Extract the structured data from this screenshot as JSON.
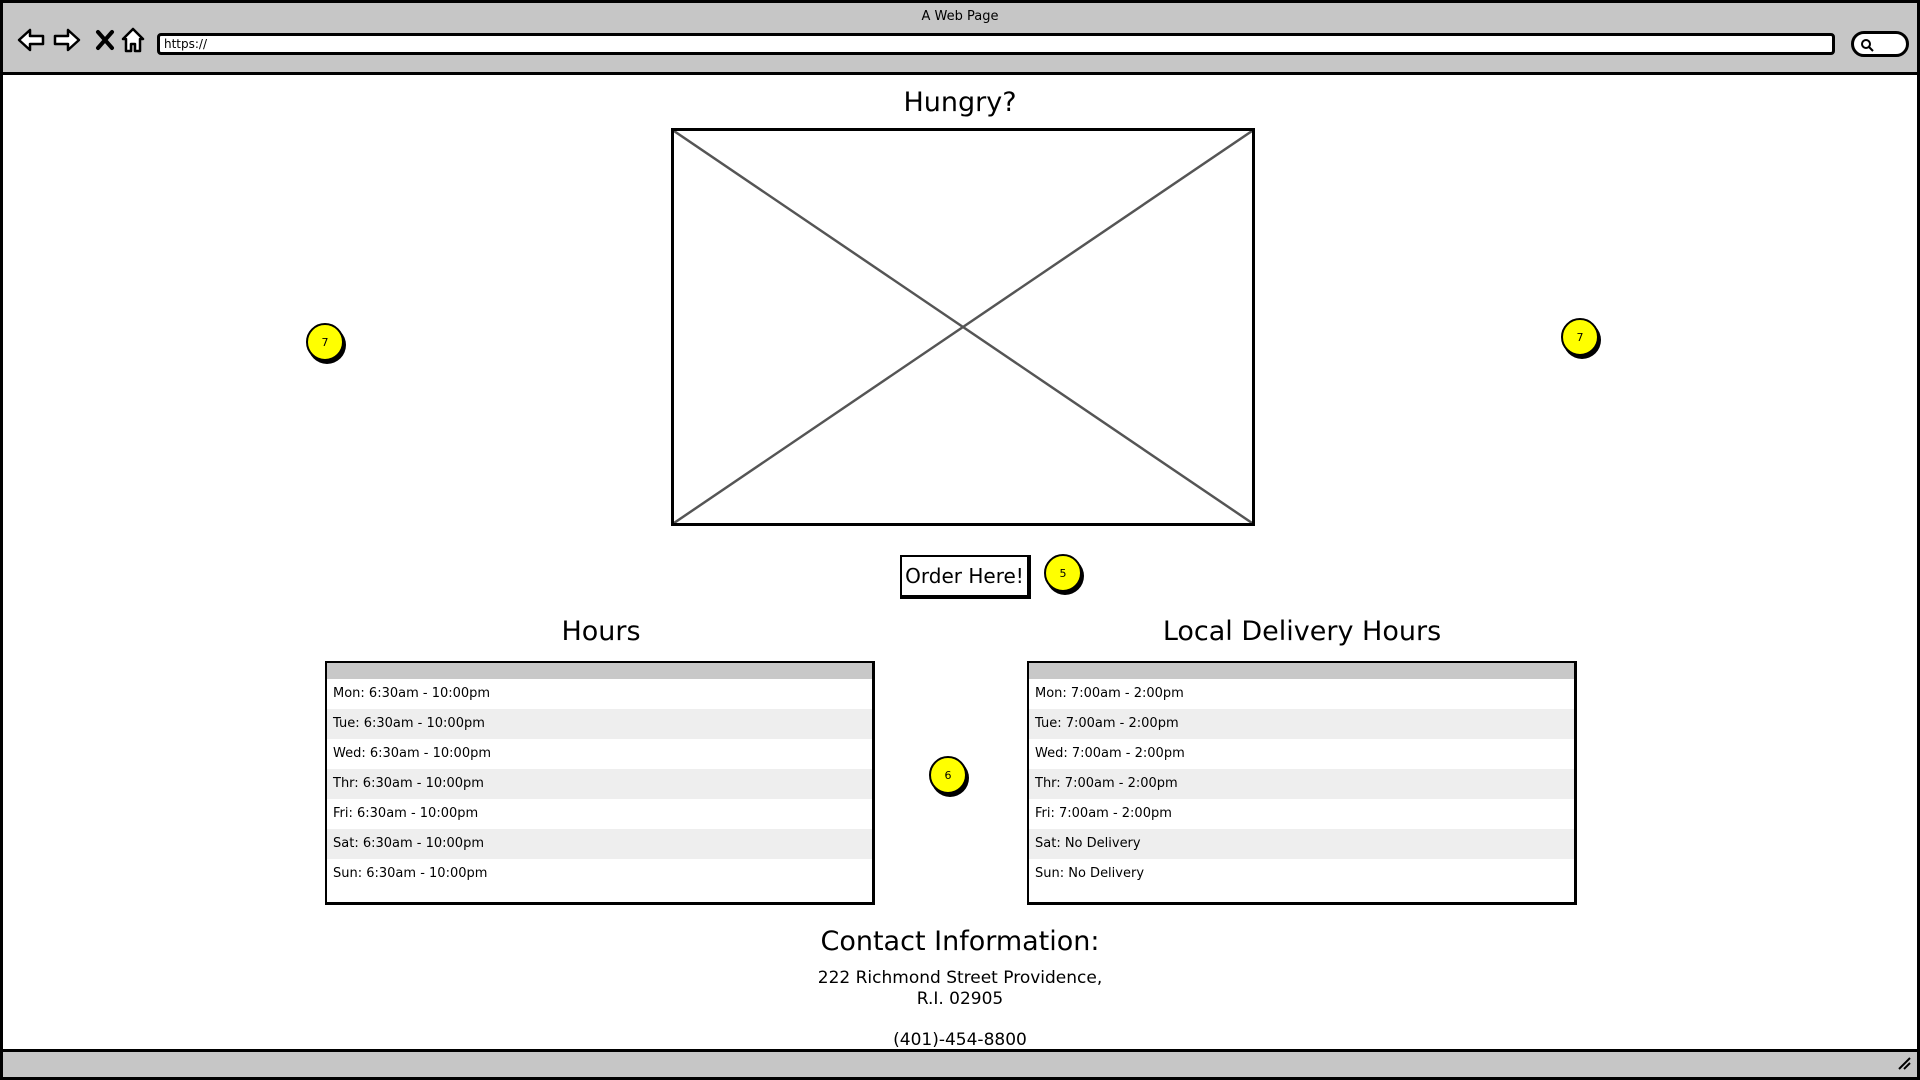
{
  "window": {
    "title": "A Web Page"
  },
  "browser": {
    "url": "https://",
    "icons": [
      "back-arrow-icon",
      "forward-arrow-icon",
      "close-x-icon",
      "home-icon",
      "search-icon",
      "resize-grip-icon"
    ]
  },
  "page": {
    "headline": "Hungry?",
    "order_button": "Order Here!",
    "hours": {
      "title": "Hours",
      "rows": [
        "Mon: 6:30am - 10:00pm",
        "Tue: 6:30am - 10:00pm",
        "Wed: 6:30am - 10:00pm",
        "Thr: 6:30am - 10:00pm",
        "Fri: 6:30am - 10:00pm",
        "Sat: 6:30am - 10:00pm",
        "Sun: 6:30am - 10:00pm"
      ]
    },
    "delivery": {
      "title": "Local Delivery Hours",
      "rows": [
        "Mon: 7:00am - 2:00pm",
        "Tue: 7:00am - 2:00pm",
        "Wed: 7:00am - 2:00pm",
        "Thr: 7:00am - 2:00pm",
        "Fri: 7:00am - 2:00pm",
        "Sat: No Delivery",
        "Sun: No Delivery"
      ]
    },
    "contact": {
      "title": "Contact Information:",
      "address_line1": "222 Richmond Street Providence,",
      "address_line2": "R.I. 02905",
      "phone": "(401)-454-8800"
    }
  },
  "markers": {
    "left": "7",
    "right": "7",
    "order": "5",
    "tables": "6"
  },
  "colors": {
    "chrome": "#c6c6c6",
    "marker": "#ffff00",
    "table_header": "#c8c8c8",
    "row_alt": "#eeeeee"
  }
}
